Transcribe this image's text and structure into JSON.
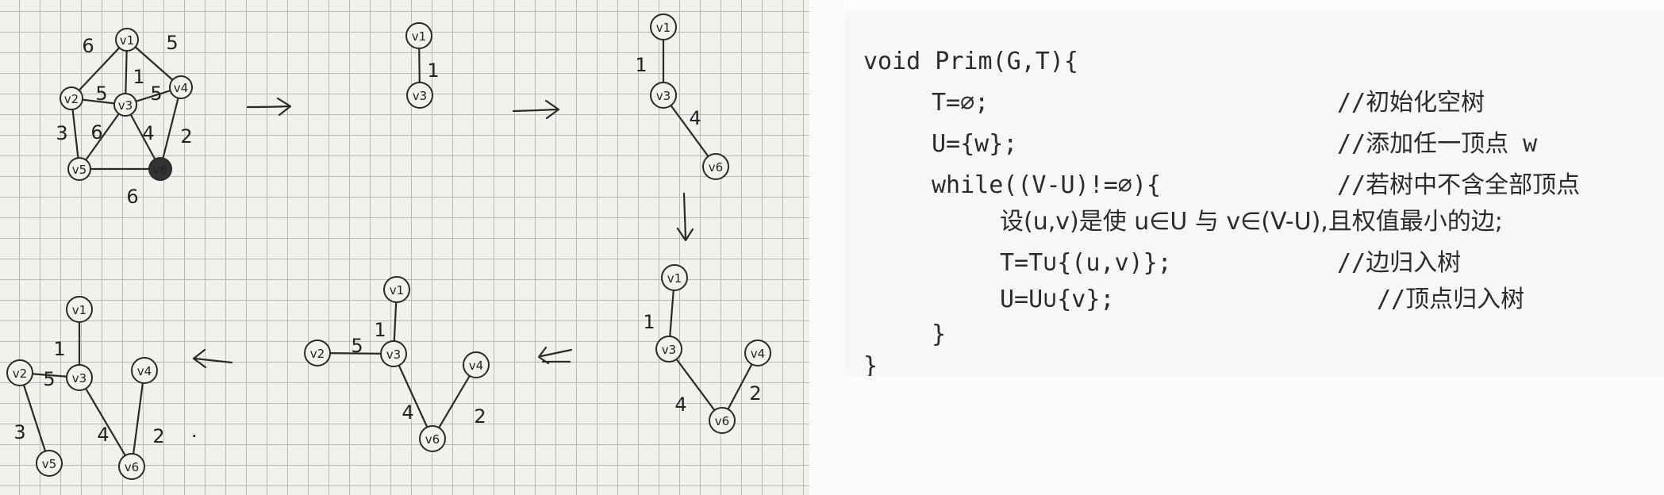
{
  "sketch": {
    "graphs": [
      {
        "id": "full-graph",
        "nodes": [
          {
            "id": "v1",
            "label": "V1"
          },
          {
            "id": "v2",
            "label": "V2"
          },
          {
            "id": "v3",
            "label": "V3"
          },
          {
            "id": "v4",
            "label": "V4"
          },
          {
            "id": "v5",
            "label": "V5"
          },
          {
            "id": "v6",
            "label": "V6"
          }
        ],
        "edges": [
          {
            "from": "v1",
            "to": "v2",
            "weight": "6"
          },
          {
            "from": "v1",
            "to": "v3",
            "weight": "1"
          },
          {
            "from": "v1",
            "to": "v4",
            "weight": "5"
          },
          {
            "from": "v2",
            "to": "v3",
            "weight": "5"
          },
          {
            "from": "v3",
            "to": "v4",
            "weight": "5"
          },
          {
            "from": "v2",
            "to": "v5",
            "weight": "3"
          },
          {
            "from": "v3",
            "to": "v5",
            "weight": "6"
          },
          {
            "from": "v3",
            "to": "v6",
            "weight": "4"
          },
          {
            "from": "v4",
            "to": "v6",
            "weight": "2"
          },
          {
            "from": "v5",
            "to": "v6",
            "weight": "6"
          }
        ]
      },
      {
        "id": "step-1",
        "nodes": [
          {
            "id": "v1",
            "label": "V1"
          },
          {
            "id": "v3",
            "label": "V3"
          }
        ],
        "edges": [
          {
            "from": "v1",
            "to": "v3",
            "weight": "1"
          }
        ]
      },
      {
        "id": "step-2",
        "nodes": [
          {
            "id": "v1",
            "label": "V1"
          },
          {
            "id": "v3",
            "label": "V3"
          },
          {
            "id": "v6",
            "label": "V6"
          }
        ],
        "edges": [
          {
            "from": "v1",
            "to": "v3",
            "weight": "1"
          },
          {
            "from": "v3",
            "to": "v6",
            "weight": "4"
          }
        ]
      },
      {
        "id": "step-3",
        "nodes": [
          {
            "id": "v1",
            "label": "V1"
          },
          {
            "id": "v3",
            "label": "V3"
          },
          {
            "id": "v4",
            "label": "V4"
          },
          {
            "id": "v6",
            "label": "V6"
          }
        ],
        "edges": [
          {
            "from": "v1",
            "to": "v3",
            "weight": "1"
          },
          {
            "from": "v3",
            "to": "v6",
            "weight": "4"
          },
          {
            "from": "v4",
            "to": "v6",
            "weight": "2"
          }
        ]
      },
      {
        "id": "step-4",
        "nodes": [
          {
            "id": "v1",
            "label": "V1"
          },
          {
            "id": "v2",
            "label": "V2"
          },
          {
            "id": "v3",
            "label": "V3"
          },
          {
            "id": "v4",
            "label": "V4"
          },
          {
            "id": "v6",
            "label": "V6"
          }
        ],
        "edges": [
          {
            "from": "v1",
            "to": "v3",
            "weight": "1"
          },
          {
            "from": "v2",
            "to": "v3",
            "weight": "5"
          },
          {
            "from": "v3",
            "to": "v6",
            "weight": "4"
          },
          {
            "from": "v4",
            "to": "v6",
            "weight": "2"
          }
        ]
      },
      {
        "id": "step-5",
        "nodes": [
          {
            "id": "v1",
            "label": "V1"
          },
          {
            "id": "v2",
            "label": "V2"
          },
          {
            "id": "v3",
            "label": "V3"
          },
          {
            "id": "v4",
            "label": "V4"
          },
          {
            "id": "v5",
            "label": "V5"
          },
          {
            "id": "v6",
            "label": "V6"
          }
        ],
        "edges": [
          {
            "from": "v1",
            "to": "v3",
            "weight": "1"
          },
          {
            "from": "v2",
            "to": "v3",
            "weight": "5"
          },
          {
            "from": "v2",
            "to": "v5",
            "weight": "3"
          },
          {
            "from": "v3",
            "to": "v6",
            "weight": "4"
          },
          {
            "from": "v4",
            "to": "v6",
            "weight": "2"
          }
        ]
      }
    ],
    "final_mark": "."
  },
  "code": {
    "lines": [
      {
        "code": "void Prim(G,T){",
        "comment": ""
      },
      {
        "code": "T=∅;",
        "comment": "//初始化空树"
      },
      {
        "code": "U={w};",
        "comment": "//添加任一顶点 w"
      },
      {
        "code": "while((V-U)!=∅){",
        "comment": "//若树中不含全部顶点"
      },
      {
        "code": "设(u,v)是使 u∈U 与 v∈(V-U),且权值最小的边;",
        "comment": ""
      },
      {
        "code": "T=T∪{(u,v)};",
        "comment": "//边归入树"
      },
      {
        "code": "U=U∪{v};",
        "comment": "//顶点归入树"
      },
      {
        "code": "}",
        "comment": ""
      },
      {
        "code": "}",
        "comment": ""
      }
    ]
  }
}
